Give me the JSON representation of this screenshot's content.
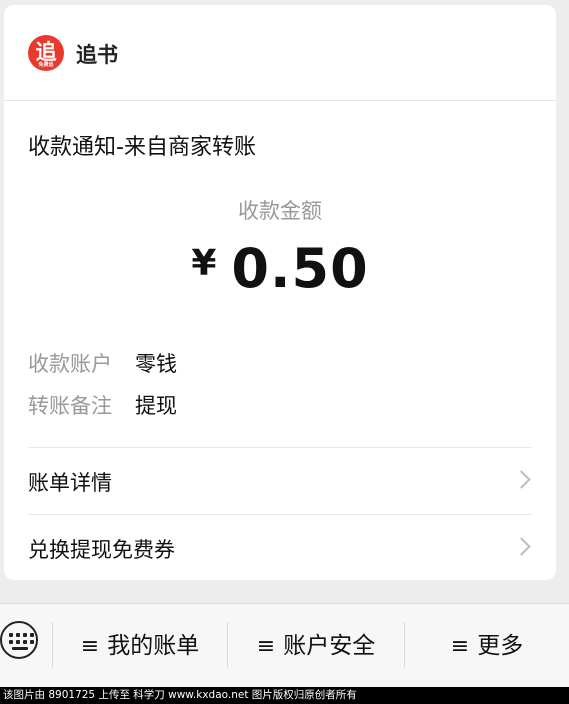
{
  "header": {
    "logo_char": "追",
    "logo_sub": "免费追",
    "app_name": "追书"
  },
  "notice": {
    "title": "收款通知-来自商家转账",
    "amount_label": "收款金额",
    "currency": "¥",
    "amount": "0.50"
  },
  "details": [
    {
      "key": "收款账户",
      "value": "零钱"
    },
    {
      "key": "转账备注",
      "value": "提现"
    }
  ],
  "links": [
    {
      "label": "账单详情"
    },
    {
      "label": "兑换提现免费券"
    }
  ],
  "bottom_menu": {
    "hamburger": "≡",
    "items": [
      {
        "label": "我的账单"
      },
      {
        "label": "账户安全"
      },
      {
        "label": "更多"
      }
    ]
  },
  "watermark": "该图片由 8901725 上传至 科学刀 www.kxdao.net 图片版权归原创者所有",
  "colors": {
    "logo_bg": "#e8392c",
    "page_bg": "#ededed",
    "muted_text": "#999999"
  }
}
